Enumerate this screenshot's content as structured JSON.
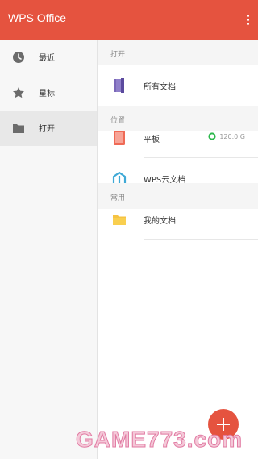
{
  "app": {
    "title": "WPS Office"
  },
  "sidebar": {
    "items": [
      {
        "label": "最近",
        "icon": "clock-icon"
      },
      {
        "label": "星标",
        "icon": "star-icon"
      },
      {
        "label": "打开",
        "icon": "folder-icon",
        "active": true
      }
    ]
  },
  "content": {
    "sections": [
      {
        "label": "打开"
      },
      {
        "label": "位置"
      },
      {
        "label": "常用"
      }
    ],
    "rows": [
      {
        "label": "所有文档",
        "icon": "documents-icon"
      },
      {
        "label": "平板",
        "icon": "tablet-icon",
        "storage": "120.0 G"
      },
      {
        "label": "WPS云文档",
        "icon": "wps-cloud-icon"
      },
      {
        "label": "我的文档",
        "icon": "folder-icon"
      }
    ]
  },
  "fab": {
    "icon": "plus-icon"
  },
  "watermark": {
    "text": "GAME773.com"
  },
  "colors": {
    "accent": "#e5533f",
    "storage_ring": "#2db84d",
    "folder": "#f6c343",
    "cloud": "#3fa9d6",
    "documents": "#7a67b8"
  }
}
